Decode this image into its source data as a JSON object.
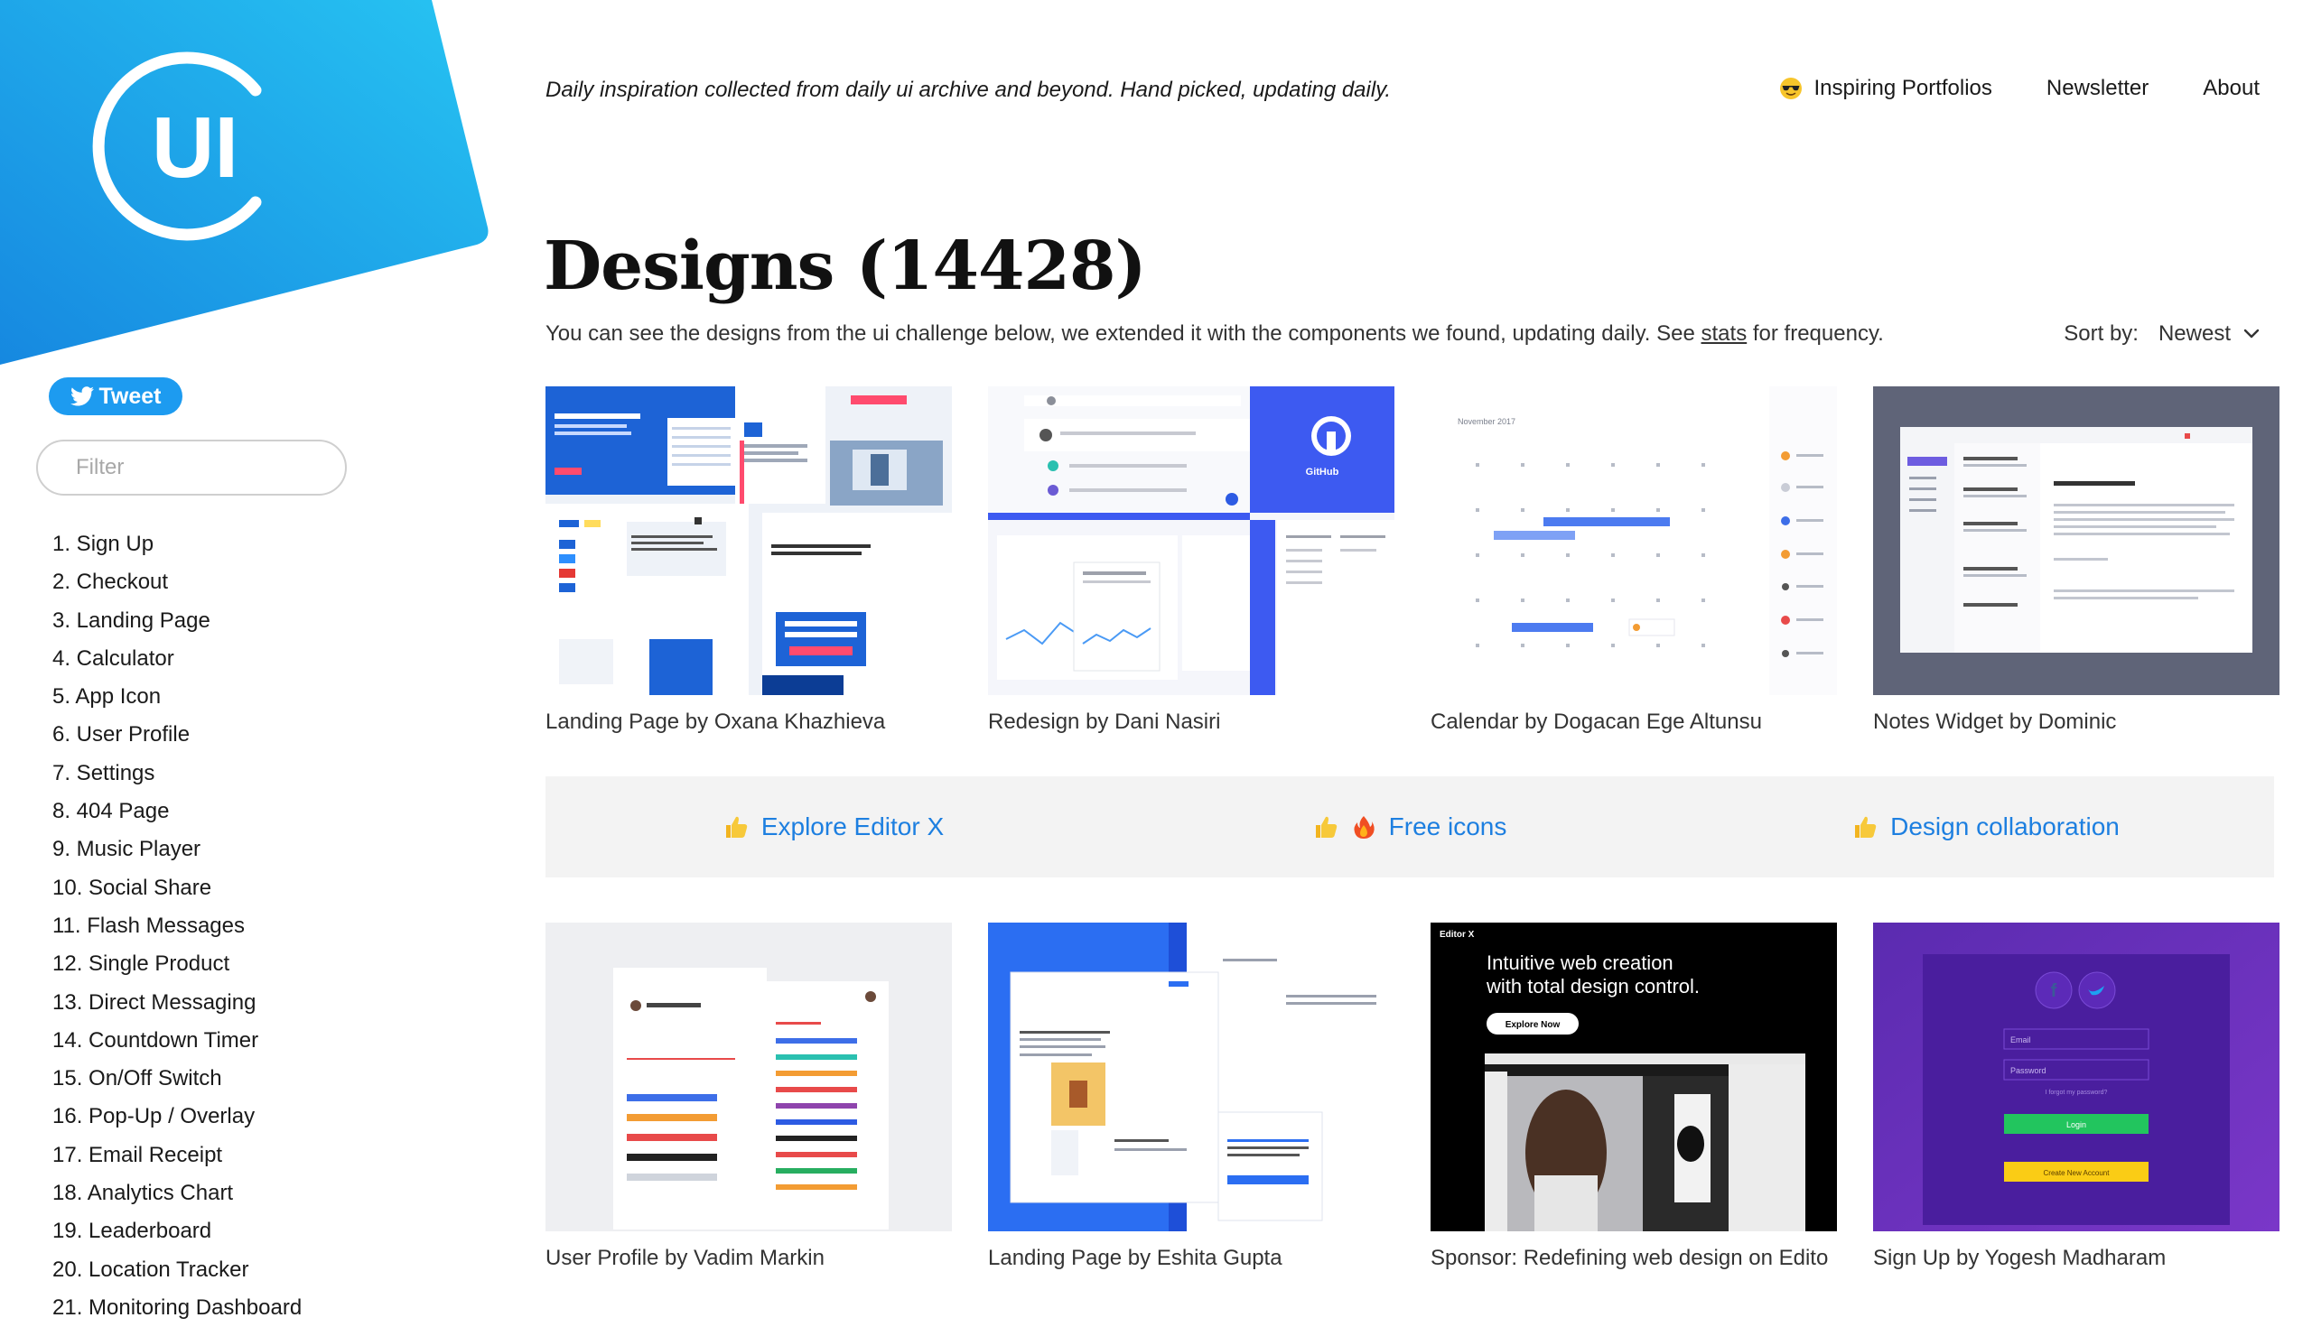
{
  "brand": {
    "logo_text": "UI"
  },
  "header": {
    "tagline": "Daily inspiration collected from daily ui archive and beyond. Hand picked, updating daily.",
    "nav": [
      {
        "label": "Inspiring Portfolios",
        "icon": "sunglasses-emoji-icon"
      },
      {
        "label": "Newsletter"
      },
      {
        "label": "About"
      }
    ]
  },
  "sidebar": {
    "tweet_label": "Tweet",
    "filter_placeholder": "Filter",
    "categories": [
      "1. Sign Up",
      "2. Checkout",
      "3. Landing Page",
      "4. Calculator",
      "5. App Icon",
      "6. User Profile",
      "7. Settings",
      "8. 404 Page",
      "9. Music Player",
      "10. Social Share",
      "11. Flash Messages",
      "12. Single Product",
      "13. Direct Messaging",
      "14. Countdown Timer",
      "15. On/Off Switch",
      "16. Pop-Up / Overlay",
      "17. Email Receipt",
      "18. Analytics Chart",
      "19. Leaderboard",
      "20. Location Tracker",
      "21. Monitoring Dashboard"
    ]
  },
  "main": {
    "title": "Designs (14428)",
    "description_prefix": "You can see the designs from the ui challenge below, we extended it with the components we found, updating daily. See ",
    "description_link": "stats",
    "description_suffix": " for frequency.",
    "sort_label": "Sort by:",
    "sort_value": "Newest",
    "cards_row1": [
      {
        "caption": "Landing Page by Oxana Khazhieva"
      },
      {
        "caption": "Redesign by Dani Nasiri"
      },
      {
        "caption": "Calendar by Dogacan Ege Altunsu"
      },
      {
        "caption": "Notes Widget by Dominic"
      }
    ],
    "promos": [
      {
        "label": "Explore Editor X",
        "icons": [
          "thumbs-up-emoji-icon"
        ]
      },
      {
        "label": "Free icons",
        "icons": [
          "thumbs-up-emoji-icon",
          "fire-emoji-icon"
        ]
      },
      {
        "label": "Design collaboration",
        "icons": [
          "thumbs-up-emoji-icon"
        ]
      }
    ],
    "cards_row2": [
      {
        "caption": "User Profile by Vadim Markin"
      },
      {
        "caption": "Landing Page by Eshita Gupta"
      },
      {
        "caption": "Sponsor: Redefining web design on Edito"
      },
      {
        "caption": "Sign Up by Yogesh Madharam"
      }
    ],
    "thumb_text": {
      "github": "GitHub",
      "calendar_month": "November 2017",
      "editorx_brand": "Editor X",
      "editorx_headline_1": "Intuitive web creation",
      "editorx_headline_2": "with total design control.",
      "editorx_cta": "Explore Now",
      "signup_email": "Email",
      "signup_password": "Password",
      "signup_forgot": "I forgot my password?",
      "signup_login": "Login",
      "signup_create": "Create New Account"
    }
  },
  "colors": {
    "brand_blue": "#1aa3e8",
    "link_blue": "#1d7fe0",
    "tweet_blue": "#1d9bf0"
  }
}
